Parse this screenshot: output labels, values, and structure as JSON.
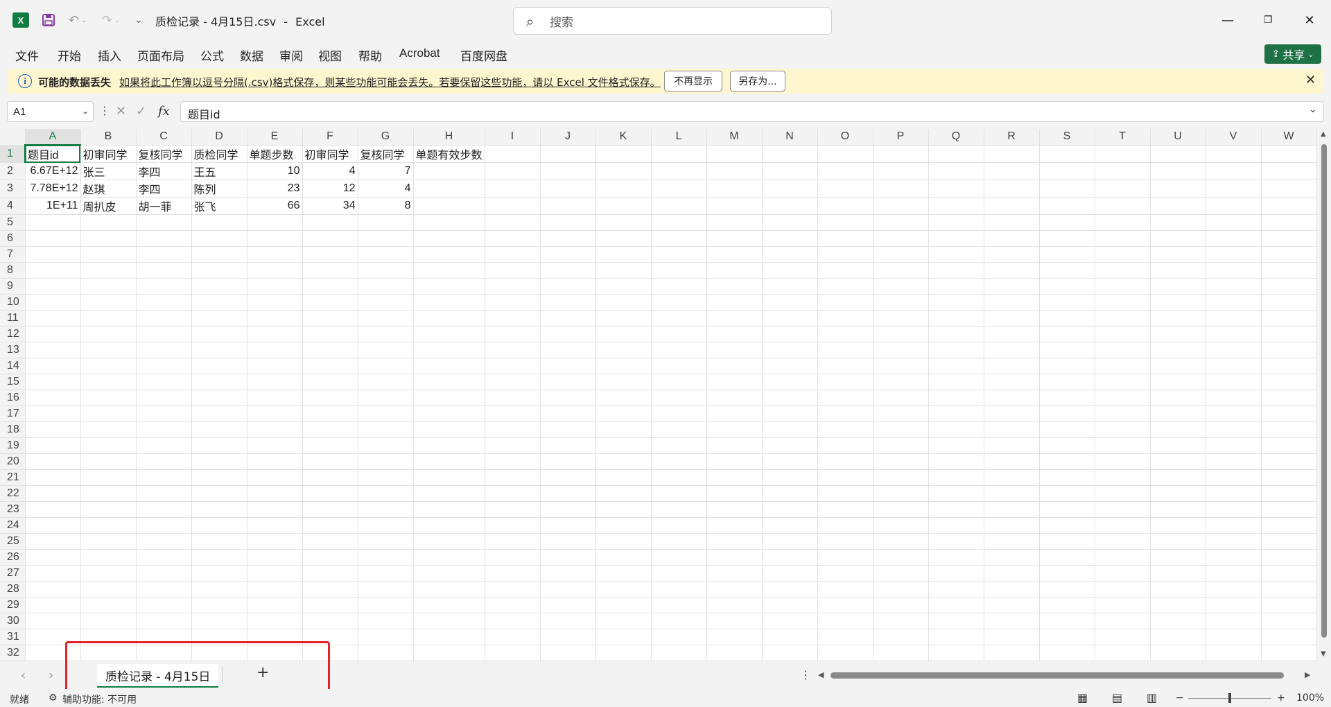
{
  "titlebar": {
    "app_icon": "excel-icon",
    "document_title": "质检记录 - 4月15日.csv",
    "app_name": "Excel",
    "search_placeholder": "搜索",
    "qat_icons": [
      "save-icon",
      "undo-icon",
      "redo-icon",
      "customize-qat-icon"
    ]
  },
  "menu": {
    "items": [
      "文件",
      "开始",
      "插入",
      "页面布局",
      "公式",
      "数据",
      "审阅",
      "视图",
      "帮助",
      "Acrobat",
      "百度网盘"
    ],
    "share_label": "共享"
  },
  "infobar": {
    "title": "可能的数据丢失",
    "message": "如果将此工作簿以逗号分隔(.csv)格式保存，则某些功能可能会丢失。若要保留这些功能，请以 Excel 文件格式保存。",
    "dont_show_label": "不再显示",
    "save_as_label": "另存为..."
  },
  "formula_bar": {
    "name_box": "A1",
    "fx": "fx",
    "formula": "题目id"
  },
  "grid": {
    "columns": [
      "A",
      "B",
      "C",
      "D",
      "E",
      "F",
      "G",
      "H",
      "I",
      "J",
      "K",
      "L",
      "M",
      "N",
      "O",
      "P",
      "Q",
      "R",
      "S",
      "T",
      "U",
      "V",
      "W"
    ],
    "rows": [
      [
        "题目id",
        "初审同学",
        "复核同学",
        "质检同学",
        "单题步数",
        "初审同学",
        "复核同学",
        "单题有效步数"
      ],
      [
        "6.67E+12",
        "张三",
        "李四",
        "王五",
        "10",
        "4",
        "7",
        ""
      ],
      [
        "7.78E+12",
        "赵琪",
        "李四",
        "陈列",
        "23",
        "12",
        "4",
        ""
      ],
      [
        "1E+11",
        "周扒皮",
        "胡一菲",
        "张飞",
        "66",
        "34",
        "8",
        ""
      ]
    ],
    "row_count": 33
  },
  "sheets": {
    "active_tab": "质检记录 - 4月15日",
    "add_label": "+"
  },
  "status": {
    "ready": "就绪",
    "accessibility": "辅助功能: 不可用",
    "zoom": "100%"
  }
}
